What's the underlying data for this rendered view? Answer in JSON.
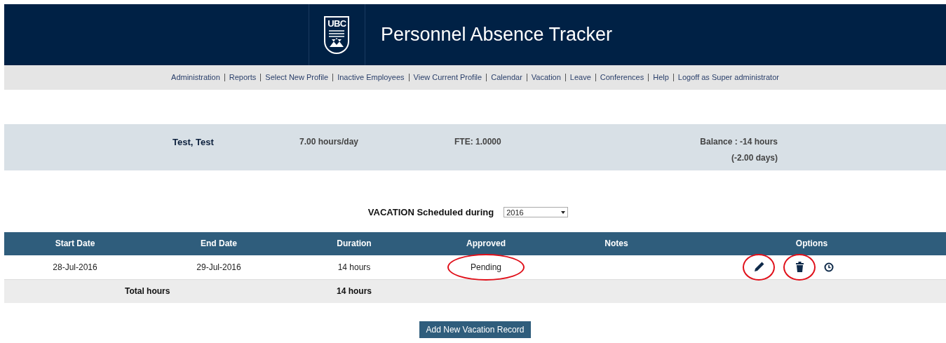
{
  "header": {
    "logo_text": "UBC",
    "title": "Personnel Absence Tracker"
  },
  "nav": [
    "Administration",
    "Reports",
    "Select New Profile",
    "Inactive Employees",
    "View Current Profile",
    "Calendar",
    "Vacation",
    "Leave",
    "Conferences",
    "Help",
    "Logoff as Super administrator"
  ],
  "profile": {
    "name": "Test, Test",
    "hours_per_day": "7.00 hours/day",
    "fte": "FTE: 1.0000",
    "balance": "Balance : -14 hours",
    "balance_days": "(-2.00 days)"
  },
  "filter": {
    "label": "VACATION Scheduled during",
    "year": "2016"
  },
  "table": {
    "columns": [
      "Start Date",
      "End Date",
      "Duration",
      "Approved",
      "Notes",
      "Options"
    ],
    "rows": [
      {
        "start": "28-Jul-2016",
        "end": "29-Jul-2016",
        "duration": "14 hours",
        "approved": "Pending",
        "approved_circled": true,
        "options": [
          {
            "kind": "edit",
            "circled": true
          },
          {
            "kind": "delete",
            "circled": true
          },
          {
            "kind": "history",
            "circled": false
          }
        ]
      }
    ],
    "total": {
      "label": "Total hours",
      "duration": "14 hours"
    }
  },
  "add_button": "Add New Vacation Record"
}
